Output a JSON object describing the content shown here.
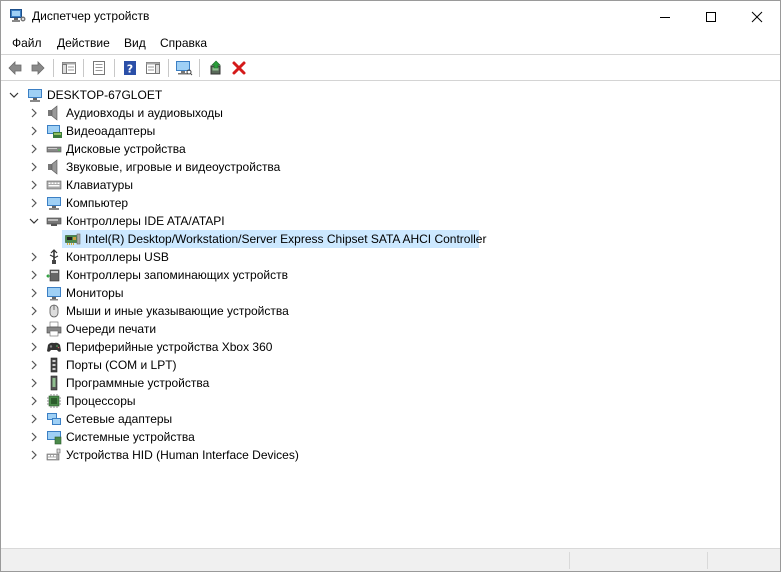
{
  "window": {
    "title": "Диспетчер устройств"
  },
  "menu": [
    {
      "label": "Файл"
    },
    {
      "label": "Действие"
    },
    {
      "label": "Вид"
    },
    {
      "label": "Справка"
    }
  ],
  "tree": {
    "root": "DESKTOP-67GLOET",
    "items": [
      {
        "label": "Аудиовходы и аудиовыходы",
        "icon": "speaker-icon",
        "expanded": false
      },
      {
        "label": "Видеоадаптеры",
        "icon": "display-adapter-icon",
        "expanded": false
      },
      {
        "label": "Дисковые устройства",
        "icon": "disk-drive-icon",
        "expanded": false
      },
      {
        "label": "Звуковые, игровые и видеоустройства",
        "icon": "speaker-icon",
        "expanded": false
      },
      {
        "label": "Клавиатуры",
        "icon": "keyboard-icon",
        "expanded": false
      },
      {
        "label": "Компьютер",
        "icon": "computer-icon",
        "expanded": false
      },
      {
        "label": "Контроллеры IDE ATA/ATAPI",
        "icon": "ide-controller-icon",
        "expanded": true,
        "children": [
          {
            "label": "Intel(R) Desktop/Workstation/Server Express Chipset SATA AHCI Controller",
            "icon": "controller-card-icon",
            "selected": true
          }
        ]
      },
      {
        "label": "Контроллеры USB",
        "icon": "usb-icon",
        "expanded": false
      },
      {
        "label": "Контроллеры запоминающих устройств",
        "icon": "storage-controller-icon",
        "expanded": false
      },
      {
        "label": "Мониторы",
        "icon": "monitor-icon",
        "expanded": false
      },
      {
        "label": "Мыши и иные указывающие устройства",
        "icon": "mouse-icon",
        "expanded": false
      },
      {
        "label": "Очереди печати",
        "icon": "printer-icon",
        "expanded": false
      },
      {
        "label": "Периферийные устройства Xbox 360",
        "icon": "gamepad-icon",
        "expanded": false
      },
      {
        "label": "Порты (COM и LPT)",
        "icon": "port-icon",
        "expanded": false
      },
      {
        "label": "Программные устройства",
        "icon": "software-device-icon",
        "expanded": false
      },
      {
        "label": "Процессоры",
        "icon": "processor-icon",
        "expanded": false
      },
      {
        "label": "Сетевые адаптеры",
        "icon": "network-adapter-icon",
        "expanded": false
      },
      {
        "label": "Системные устройства",
        "icon": "system-device-icon",
        "expanded": false
      },
      {
        "label": "Устройства HID (Human Interface Devices)",
        "icon": "hid-icon",
        "expanded": false
      }
    ]
  },
  "colors": {
    "selection": "#cce8ff",
    "delete_red": "#d41a1a",
    "enable_green": "#2a9d3a",
    "help_blue": "#2b4fa8"
  }
}
